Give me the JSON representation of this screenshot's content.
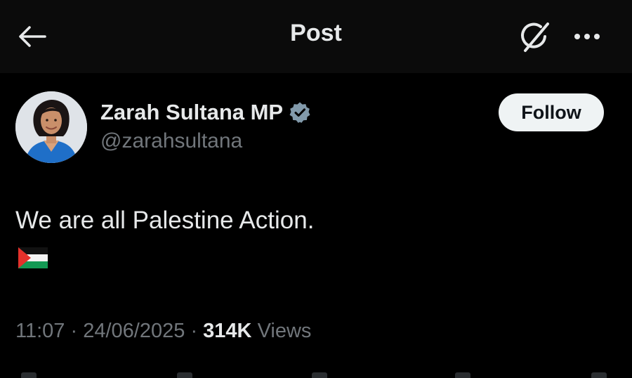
{
  "header": {
    "title": "Post",
    "back_icon": "arrow-left-icon",
    "grok_icon": "grok-icon",
    "more_icon": "more-horizontal-icon"
  },
  "post": {
    "author": {
      "display_name": "Zarah Sultana MP",
      "handle": "@zarahsultana",
      "verified": true,
      "verified_color": "#829aab"
    },
    "follow_label": "Follow",
    "text": "We are all Palestine Action.",
    "emoji": "Palestine flag",
    "time": "11:07",
    "separator": "·",
    "date": "24/06/2025",
    "views_count": "314K",
    "views_label": "Views"
  },
  "colors": {
    "background": "#000000",
    "header_background": "#0b0b0b",
    "primary_text": "#e7e9ea",
    "secondary_text": "#71767b",
    "follow_button_bg": "#eff3f4"
  }
}
